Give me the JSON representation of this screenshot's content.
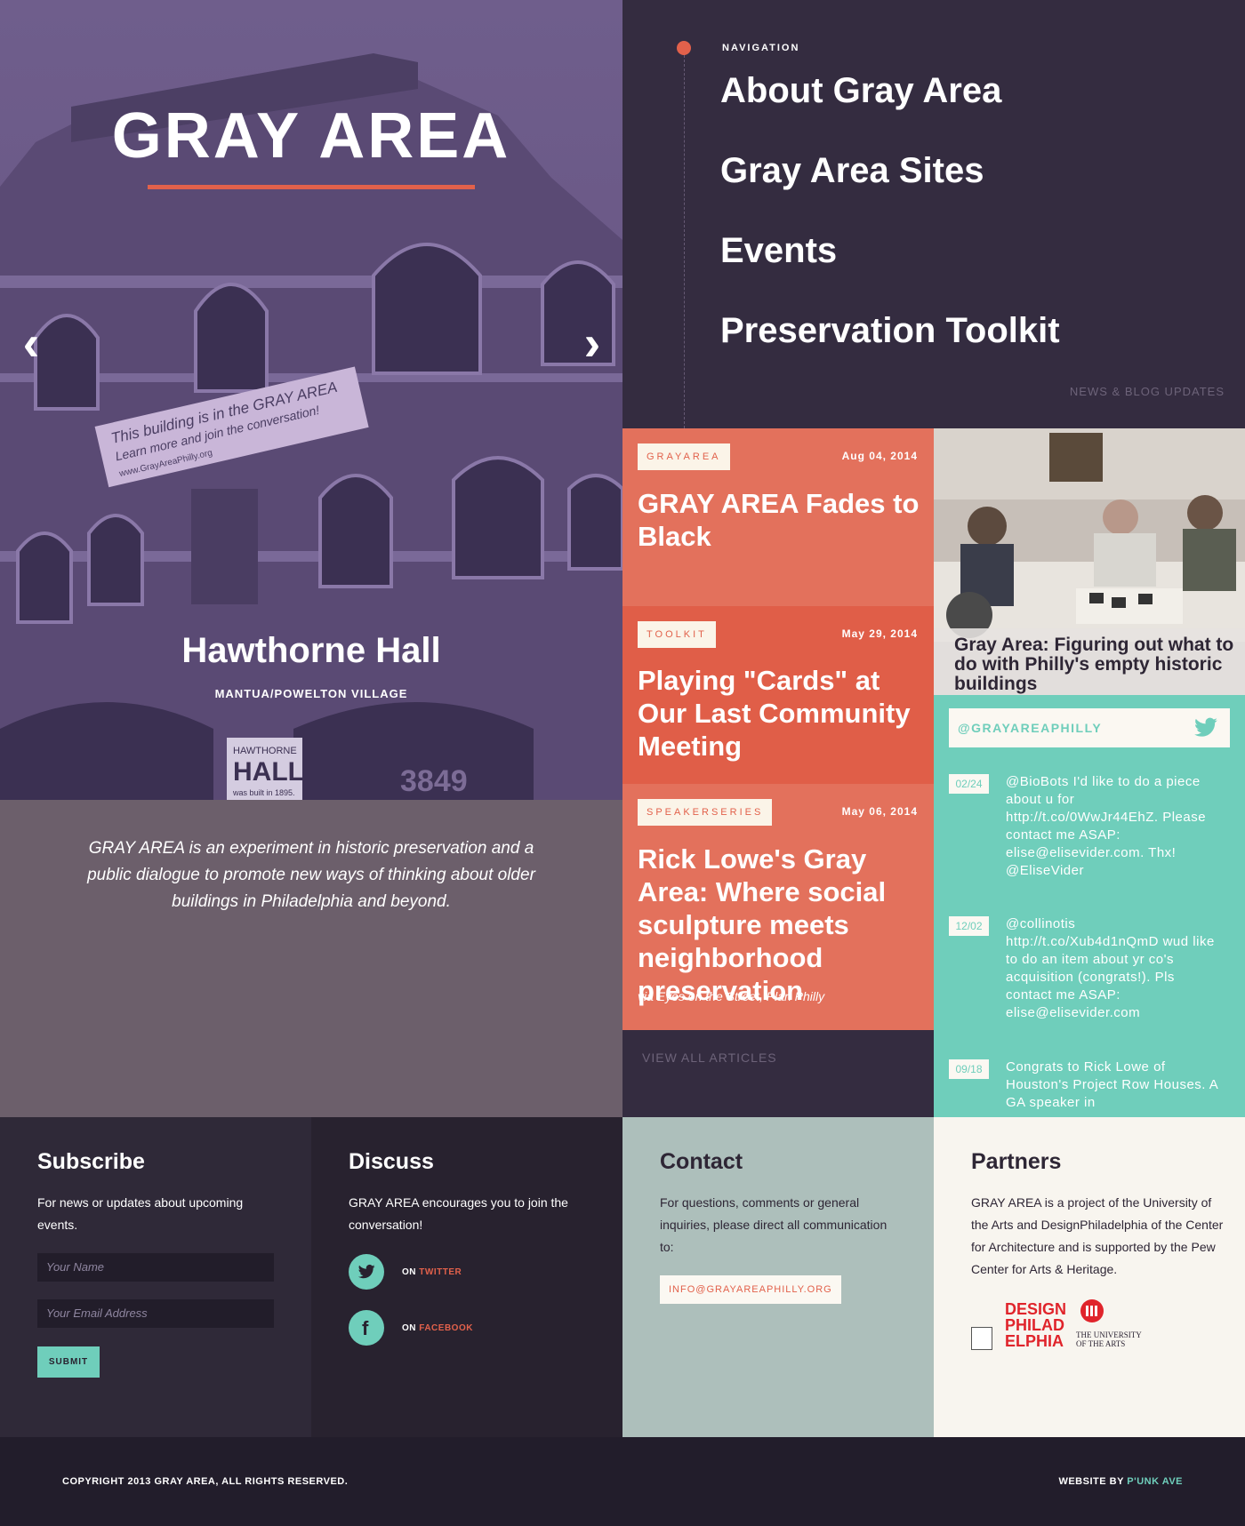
{
  "hero": {
    "title": "GRAY AREA",
    "prev_arrow": "‹",
    "next_arrow": "›",
    "slide_title": "Hawthorne Hall",
    "slide_location": "MANTUA/POWELTON VILLAGE",
    "banner_text": [
      "This building is in the GRAY AREA",
      "Learn more and join the conversation!",
      "www.GrayAreaPhilly.org"
    ],
    "sign_text": [
      "HAWTHORNE",
      "HALL",
      "was built in 1895."
    ],
    "street_number": "3849"
  },
  "intro": {
    "text": "GRAY AREA is an experiment in historic preservation and a public dialogue to promote new ways of thinking about older buildings in Philadelphia and beyond."
  },
  "nav": {
    "label": "NAVIGATION",
    "items": [
      "About Gray Area",
      "Gray Area Sites",
      "Events",
      "Preservation Toolkit"
    ],
    "news_link": "NEWS & BLOG UPDATES"
  },
  "articles": [
    {
      "tag": "GRAYAREA",
      "date": "Aug 04, 2014",
      "title": "GRAY AREA Fades to Black",
      "via": ""
    },
    {
      "tag": "TOOLKIT",
      "date": "May 29, 2014",
      "title": "Playing \"Cards\" at Our Last Community Meeting",
      "via": ""
    },
    {
      "tag": "SPEAKERSERIES",
      "date": "May 06, 2014",
      "title": "Rick Lowe's Gray Area: Where social sculpture meets neighborhood preservation",
      "via": "via Eyes on the Street, Plan Philly"
    }
  ],
  "view_all": "VIEW ALL ARTICLES",
  "photo_caption": "Gray Area: Figuring out what to do with Philly's empty historic buildings",
  "twitter": {
    "handle": "@GRAYAREAPHILLY",
    "icon": "twitter-bird-icon",
    "tweets": [
      {
        "date": "02/24",
        "text": "@BioBots I'd like to do a piece about u for http://t.co/0WwJr44EhZ. Please contact me ASAP: elise@elisevider.com. Thx! @EliseVider"
      },
      {
        "date": "12/02",
        "text": "@collinotis http://t.co/Xub4d1nQmD wud like to do an item about yr co's acquisition (congrats!). Pls contact me ASAP: elise@elisevider.com"
      },
      {
        "date": "09/18",
        "text": "Congrats to Rick Lowe of Houston's Project Row Houses. A GA speaker in"
      }
    ]
  },
  "subscribe": {
    "heading": "Subscribe",
    "text": "For news or updates about upcoming events.",
    "name_placeholder": "Your Name",
    "email_placeholder": "Your Email Address",
    "submit": "SUBMIT"
  },
  "discuss": {
    "heading": "Discuss",
    "text": "GRAY AREA encourages you to join the conversation!",
    "twitter_prefix": "ON ",
    "twitter_label": "TWITTER",
    "facebook_prefix": "ON ",
    "facebook_label": "FACEBOOK"
  },
  "contact": {
    "heading": "Contact",
    "text": "For questions, comments or general inquiries, please direct all communication to:",
    "email": "INFO@GRAYAREAPHILLY.ORG"
  },
  "partners": {
    "heading": "Partners",
    "text": "GRAY AREA is a project of the University of the Arts and DesignPhiladelphia of the Center for Architecture and is supported by the Pew Center for Arts & Heritage.",
    "logo1_lines": [
      "DESIGN",
      "PHILAD",
      "ELPHIA"
    ],
    "logo2_lines": [
      "THE UNIVERSITY",
      "OF THE ARTS"
    ]
  },
  "footer": {
    "copyright": "COPYRIGHT 2013 GRAY AREA, ALL RIGHTS RESERVED.",
    "credit_prefix": "WEBSITE BY ",
    "credit_name": "P'UNK AVE"
  },
  "colors": {
    "accent": "#e2614b",
    "teal": "#6fcebb",
    "purple_dark": "#342c40",
    "intro_bg": "#6c5f6b"
  }
}
